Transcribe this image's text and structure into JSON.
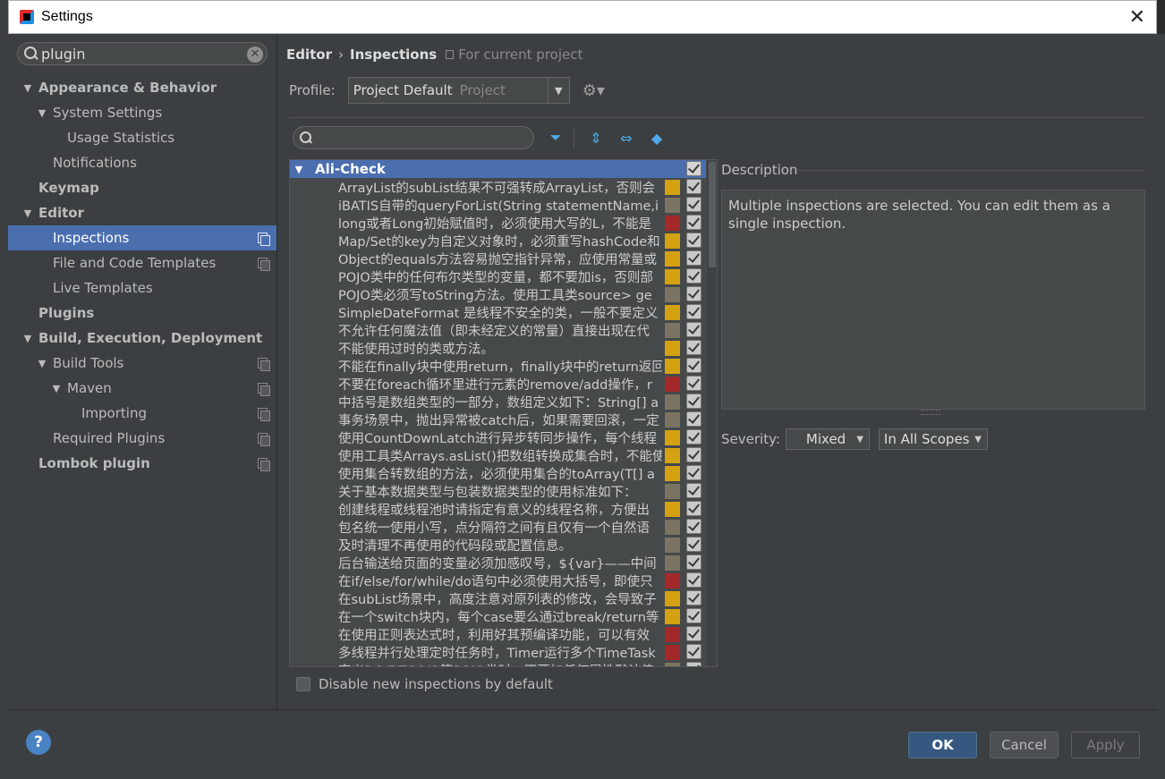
{
  "window": {
    "title": "Settings"
  },
  "colors": {
    "selection": "#4b6eaf",
    "sev_warning": "#d4a112",
    "sev_info": "#7b7462",
    "sev_error": "#a3282a",
    "checkbox": "#c9c9c9"
  },
  "search": {
    "value": "plugin"
  },
  "tree": [
    {
      "label": "Appearance & Behavior",
      "depth": 0,
      "bold": true,
      "arrow": "▼"
    },
    {
      "label": "System Settings",
      "depth": 1,
      "bold": false,
      "arrow": "▼"
    },
    {
      "label": "Usage Statistics",
      "depth": 2,
      "bold": false,
      "arrow": ""
    },
    {
      "label": "Notifications",
      "depth": 1,
      "bold": false,
      "arrow": ""
    },
    {
      "label": "Keymap",
      "depth": 0,
      "bold": true,
      "arrow": ""
    },
    {
      "label": "Editor",
      "depth": 0,
      "bold": true,
      "arrow": "▼"
    },
    {
      "label": "Inspections",
      "depth": 1,
      "bold": false,
      "arrow": "",
      "selected": true,
      "project": true
    },
    {
      "label": "File and Code Templates",
      "depth": 1,
      "bold": false,
      "arrow": "",
      "project": true
    },
    {
      "label": "Live Templates",
      "depth": 1,
      "bold": false,
      "arrow": ""
    },
    {
      "label": "Plugins",
      "depth": 0,
      "bold": true,
      "arrow": ""
    },
    {
      "label": "Build, Execution, Deployment",
      "depth": 0,
      "bold": true,
      "arrow": "▼"
    },
    {
      "label": "Build Tools",
      "depth": 1,
      "bold": false,
      "arrow": "▼",
      "project": true
    },
    {
      "label": "Maven",
      "depth": 2,
      "bold": false,
      "arrow": "▼",
      "project": true
    },
    {
      "label": "Importing",
      "depth": 3,
      "bold": false,
      "arrow": "",
      "project": true
    },
    {
      "label": "Required Plugins",
      "depth": 1,
      "bold": false,
      "arrow": "",
      "project": true
    },
    {
      "label": "Lombok plugin",
      "depth": 0,
      "bold": true,
      "arrow": "",
      "project": true
    }
  ],
  "breadcrumb": {
    "parent": "Editor",
    "separator": "›",
    "current": "Inspections",
    "scope": "For current project"
  },
  "profile": {
    "label": "Profile:",
    "value": "Project Default",
    "sub": "Project"
  },
  "inspections": {
    "group": "Ali-Check",
    "rows": [
      {
        "text": "ArrayList的subList结果不可强转成ArrayList，否则会",
        "sev": "warning"
      },
      {
        "text": "iBATIS自带的queryForList(String statementName,i",
        "sev": "info"
      },
      {
        "text": "long或者Long初始赋值时，必须使用大写的L，不能是",
        "sev": "error"
      },
      {
        "text": "Map/Set的key为自定义对象时，必须重写hashCode和",
        "sev": "warning"
      },
      {
        "text": "Object的equals方法容易抛空指针异常，应使用常量或",
        "sev": "warning"
      },
      {
        "text": "POJO类中的任何布尔类型的变量，都不要加is，否则部",
        "sev": "warning"
      },
      {
        "text": "POJO类必须写toString方法。使用工具类source> ge",
        "sev": "info"
      },
      {
        "text": "SimpleDateFormat 是线程不安全的类，一般不要定义",
        "sev": "warning"
      },
      {
        "text": "不允许任何魔法值（即未经定义的常量）直接出现在代",
        "sev": "info"
      },
      {
        "text": "不能使用过时的类或方法。",
        "sev": "warning"
      },
      {
        "text": "不能在finally块中使用return，finally块中的return返回",
        "sev": "warning"
      },
      {
        "text": "不要在foreach循环里进行元素的remove/add操作，r",
        "sev": "error"
      },
      {
        "text": "中括号是数组类型的一部分，数组定义如下：String[] a",
        "sev": "info"
      },
      {
        "text": "事务场景中，抛出异常被catch后，如果需要回滚，一定",
        "sev": "info"
      },
      {
        "text": "使用CountDownLatch进行异步转同步操作，每个线程",
        "sev": "warning"
      },
      {
        "text": "使用工具类Arrays.asList()把数组转换成集合时，不能使",
        "sev": "warning"
      },
      {
        "text": "使用集合转数组的方法，必须使用集合的toArray(T[] a",
        "sev": "warning"
      },
      {
        "text": "关于基本数据类型与包装数据类型的使用标准如下：",
        "sev": "info"
      },
      {
        "text": "创建线程或线程池时请指定有意义的线程名称，方便出",
        "sev": "warning"
      },
      {
        "text": "包名统一使用小写，点分隔符之间有且仅有一个自然语",
        "sev": "info"
      },
      {
        "text": "及时清理不再使用的代码段或配置信息。",
        "sev": "info"
      },
      {
        "text": "后台输送给页面的变量必须加感叹号，${var}——中间",
        "sev": "info"
      },
      {
        "text": "在if/else/for/while/do语句中必须使用大括号，即使只",
        "sev": "error"
      },
      {
        "text": "在subList场景中，高度注意对原列表的修改，会导致子",
        "sev": "warning"
      },
      {
        "text": "在一个switch块内，每个case要么通过break/return等",
        "sev": "warning"
      },
      {
        "text": "在使用正则表达式时，利用好其预编译功能，可以有效",
        "sev": "error"
      },
      {
        "text": "多线程并行处理定时任务时，Timer运行多个TimeTask",
        "sev": "error"
      },
      {
        "text": "定义DO/DTO/VO等POJO类时，不要加任何属性默认值",
        "sev": "info"
      }
    ]
  },
  "disable_new": {
    "label": "Disable new inspections by default"
  },
  "description": {
    "label": "Description",
    "text": "Multiple inspections are selected. You can edit them as a single inspection."
  },
  "severity": {
    "label": "Severity:",
    "value": "Mixed",
    "scope": "In All Scopes"
  },
  "buttons": {
    "ok": "OK",
    "cancel": "Cancel",
    "apply": "Apply",
    "help": "?"
  }
}
